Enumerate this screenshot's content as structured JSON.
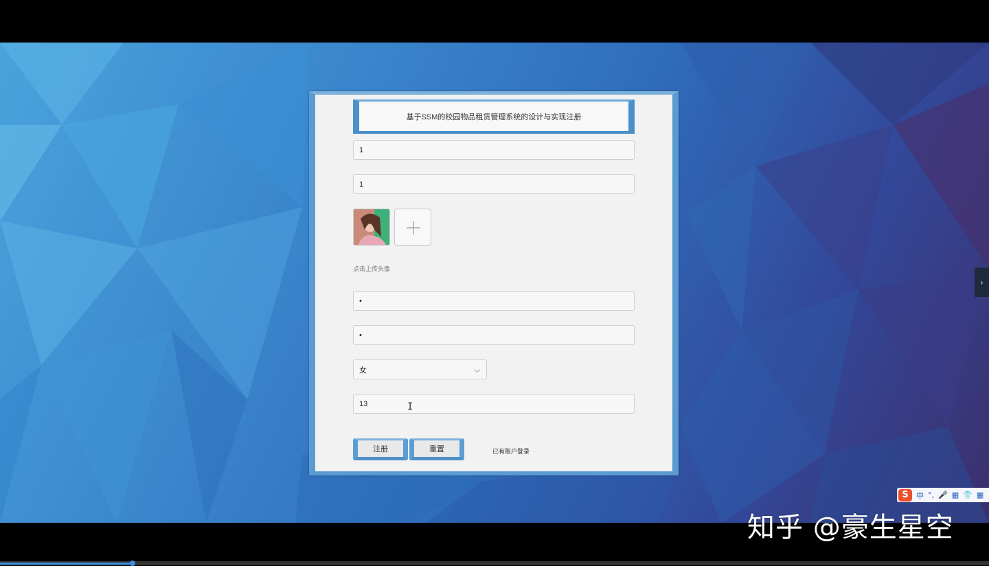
{
  "form": {
    "title": "基于SSM的校园物品租赁管理系统的设计与实现注册",
    "fields": [
      {
        "value": "1"
      },
      {
        "value": "1"
      },
      {
        "value": "•"
      },
      {
        "value": "•"
      },
      {
        "value": "13"
      }
    ],
    "avatar_hint": "点击上传头像",
    "gender_selected": "女",
    "register_label": "注册",
    "reset_label": "重置",
    "login_link": "已有账户登录"
  },
  "overlay": {
    "side_arrow": "›",
    "ime_items": [
      "中",
      "°,",
      "🎤",
      "▦",
      "👕",
      "▦"
    ],
    "watermark": "知乎 @豪生星空"
  },
  "video": {
    "progress": 0.134
  },
  "colors": {
    "accent_blue": "#5a9bd1",
    "panel_bg": "#f2f2f2"
  }
}
